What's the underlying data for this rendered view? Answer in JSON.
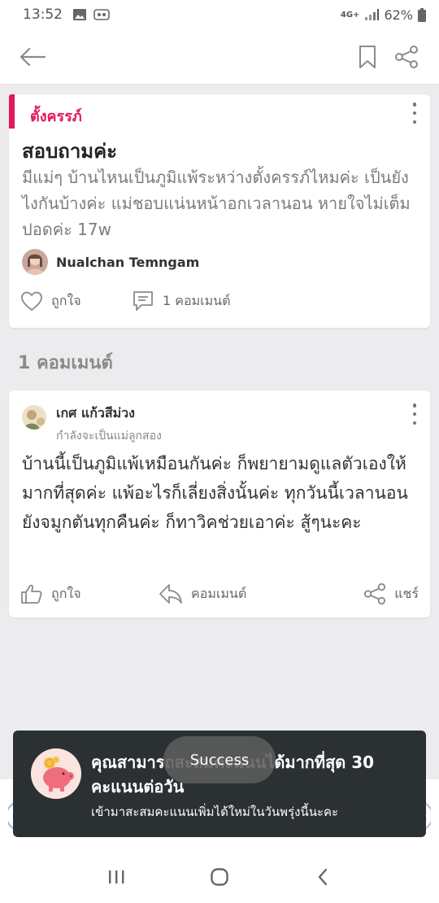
{
  "status_bar": {
    "time": "13:52",
    "network": "4G+",
    "battery": "62%"
  },
  "post": {
    "category": "ตั้งครรภ์",
    "title": "สอบถามค่ะ",
    "body": "มีแม่ๆ บ้านไหนเป็นภูมิแพ้ระหว่างตั้งครรภ์ไหมค่ะ เป็นยังไงกันบ้างค่ะ แม่ชอบแน่นหน้าอกเวลานอน หายใจไม่เต็มปอดค่ะ 17w",
    "author": "Nualchan Temngam",
    "like_label": "ถูกใจ",
    "comment_label": "1 คอมเมนต์"
  },
  "comments_header": "1 คอมเมนต์",
  "comment": {
    "author": "เกศ แก้วสีม่วง",
    "subtitle": "กำลังจะเป็นแม่ลูกสอง",
    "body": "บ้านนี้เป็นภูมิแพ้เหมือนกันค่ะ ก็พยายามดูแลตัวเองให้มากที่สุดค่ะ แพ้อะไรก็เลี่ยงสิ่งนั้นค่ะ ทุกวันนี้เวลานอนยังจมูกตันทุกคืนค่ะ ก็ทาวิคช่วยเอาค่ะ สู้ๆนะคะ",
    "like_label": "ถูกใจ",
    "reply_label": "คอมเมนต์",
    "share_label": "แชร์"
  },
  "toast": {
    "title": "คุณสามารถสะสมคะแนนได้มากที่สุด 30 คะแนนต่อวัน",
    "subtitle": "เข้ามาสะสมคะแนนเพิ่มได้ใหม่ในวันพรุ่งนี้นะคะ"
  },
  "snackbar": {
    "text": "Success"
  },
  "colors": {
    "accent": "#e2185c",
    "toast_bg": "#2b3033",
    "page_bg": "#ececee"
  }
}
